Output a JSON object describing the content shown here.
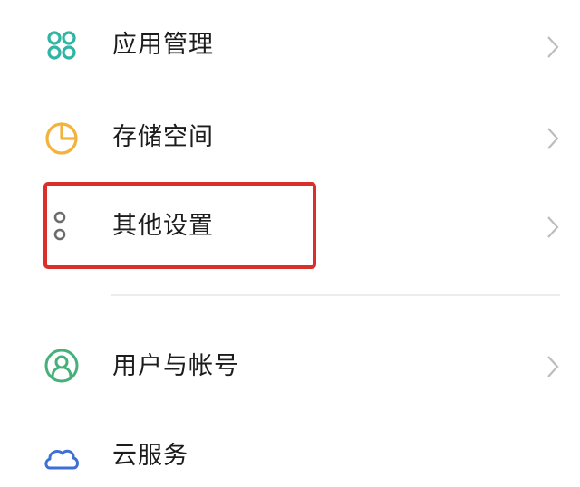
{
  "settings": {
    "items": [
      {
        "label": "应用管理",
        "icon": "apps-grid-icon",
        "color": "#2fb5a3"
      },
      {
        "label": "存储空间",
        "icon": "pie-chart-icon",
        "color": "#f2b33c"
      },
      {
        "label": "其他设置",
        "icon": "more-dots-icon",
        "color": "#6c6c6c"
      },
      {
        "label": "用户与帐号",
        "icon": "user-circle-icon",
        "color": "#45b07a"
      },
      {
        "label": "云服务",
        "icon": "cloud-icon",
        "color": "#3d6fd4"
      }
    ],
    "highlight_color": "#d9302c",
    "chevron_color": "#bdbdbd"
  }
}
